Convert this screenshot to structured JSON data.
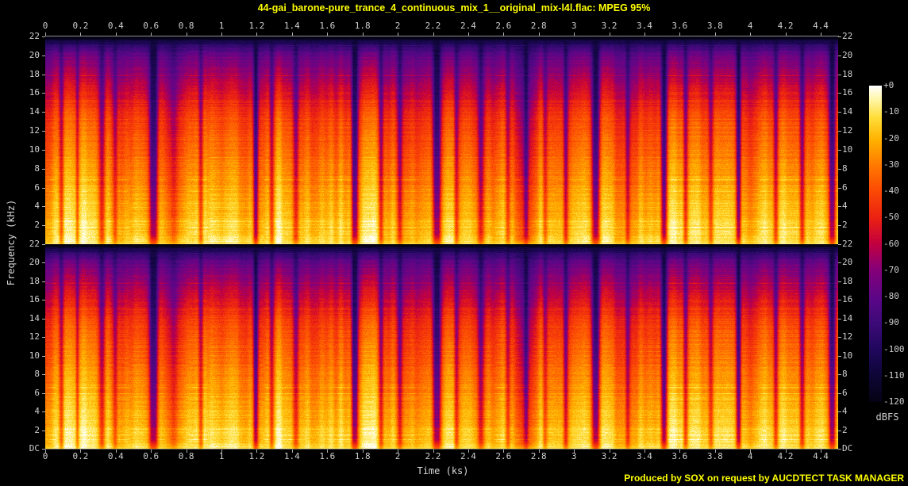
{
  "header": {
    "title": "44-gai_barone-pure_trance_4_continuous_mix_1__original_mix-l4l.flac: MPEG 95%",
    "title_color": "#ffff00"
  },
  "footer": {
    "attribution": "Produced by SOX on request by AUCDTECT TASK MANAGER",
    "attribution_color": "#ffff00"
  },
  "axes": {
    "x_label": "Time (ks)",
    "y_label": "Frequency (kHz)",
    "x_ticks": [
      "0",
      "0.2",
      "0.4",
      "0.6",
      "0.8",
      "1",
      "1.2",
      "1.4",
      "1.6",
      "1.8",
      "2",
      "2.2",
      "2.4",
      "2.6",
      "2.8",
      "3",
      "3.2",
      "3.4",
      "3.6",
      "3.8",
      "4",
      "4.2",
      "4.4"
    ],
    "y_ticks_per_channel": [
      "22",
      "20",
      "18",
      "16",
      "14",
      "12",
      "10",
      "8",
      "6",
      "4",
      "2",
      "DC"
    ],
    "tick_label_color": "#cfcfcf"
  },
  "colorbar": {
    "unit": "dBFS",
    "ticks": [
      "+0",
      "-10",
      "-20",
      "-30",
      "-40",
      "-50",
      "-60",
      "-70",
      "-80",
      "-90",
      "-100",
      "-110",
      "-120"
    ]
  },
  "chart_data": {
    "type": "heatmap",
    "title": "44-gai_barone-pure_trance_4_continuous_mix_1__original_mix-l4l.flac: MPEG 95%",
    "xlabel": "Time (ks)",
    "ylabel": "Frequency (kHz)",
    "zlabel": "dBFS",
    "x_range_ks": [
      0,
      4.46
    ],
    "y_range_khz_per_channel": [
      0,
      22
    ],
    "z_range_db": [
      -120,
      0
    ],
    "channels": [
      "left",
      "right"
    ],
    "channel_layout": "stacked",
    "grid": false,
    "legend_position": "right-colorbar",
    "major_quiet_breaks_ks": [
      0.61,
      1.74,
      2.2,
      3.1,
      3.48,
      3.9,
      4.43
    ],
    "palette_stops": [
      [
        0.0,
        "#050214"
      ],
      [
        0.08,
        "#0d0635"
      ],
      [
        0.17,
        "#21075e"
      ],
      [
        0.25,
        "#3d0a78"
      ],
      [
        0.33,
        "#5c0687"
      ],
      [
        0.42,
        "#860078"
      ],
      [
        0.5,
        "#c20040"
      ],
      [
        0.58,
        "#ea2012"
      ],
      [
        0.67,
        "#fb4a04"
      ],
      [
        0.75,
        "#ff7a00"
      ],
      [
        0.83,
        "#ffb200"
      ],
      [
        0.9,
        "#ffdd38"
      ],
      [
        0.96,
        "#fff7ad"
      ],
      [
        1.0,
        "#ffffff"
      ]
    ],
    "gaps": [
      [
        0.02,
        3,
        0.45
      ],
      [
        0.04,
        2,
        0.35
      ],
      [
        0.071,
        4,
        0.5
      ],
      [
        0.088,
        3,
        0.35
      ],
      [
        0.136,
        5,
        0.95
      ],
      [
        0.16,
        10,
        0.3
      ],
      [
        0.196,
        3,
        0.5
      ],
      [
        0.265,
        3,
        0.8
      ],
      [
        0.285,
        3,
        0.5
      ],
      [
        0.316,
        4,
        0.55
      ],
      [
        0.39,
        4,
        0.95
      ],
      [
        0.423,
        3,
        0.5
      ],
      [
        0.447,
        3,
        0.4
      ],
      [
        0.46,
        20,
        0.15
      ],
      [
        0.494,
        6,
        0.95
      ],
      [
        0.518,
        3,
        0.55
      ],
      [
        0.549,
        4,
        0.5
      ],
      [
        0.57,
        25,
        0.2
      ],
      [
        0.583,
        3,
        0.35
      ],
      [
        0.61,
        15,
        0.25
      ],
      [
        0.606,
        3,
        0.5
      ],
      [
        0.63,
        3,
        0.3
      ],
      [
        0.656,
        3,
        0.55
      ],
      [
        0.694,
        5,
        0.95
      ],
      [
        0.734,
        3,
        0.5
      ],
      [
        0.78,
        4,
        0.9
      ],
      [
        0.807,
        3,
        0.55
      ],
      [
        0.839,
        3,
        0.4
      ],
      [
        0.874,
        3,
        0.85
      ],
      [
        0.921,
        3,
        0.5
      ],
      [
        0.954,
        3,
        0.45
      ],
      [
        0.992,
        4,
        0.9
      ]
    ],
    "seed": 12648430
  }
}
